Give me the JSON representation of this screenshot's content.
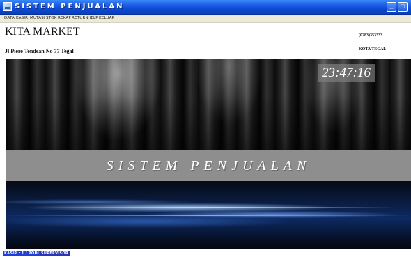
{
  "window": {
    "title": "SISTEM   PENJUALAN",
    "icon": "app-icon",
    "minimize_glyph": "_",
    "maximize_glyph": "□"
  },
  "menu": {
    "items": [
      "DATA",
      "KASIR",
      "MUTASI",
      "STOK",
      "REKAP",
      "RETURN",
      "HELP",
      "KELUAR"
    ]
  },
  "header": {
    "store_name": "KITA MARKET",
    "address": "Jl Piere Tendean No 77 Tegal",
    "phone": "(0283)353333",
    "city": "KOTA TEGAL"
  },
  "banner": {
    "clock": "23:47:16",
    "title": "SISTEM  PENJUALAN"
  },
  "status": {
    "kasir": "KASIR : 1  /  PODI",
    "role": "SUPERVISOR"
  },
  "colors": {
    "titlebar": "#0b47cf",
    "menubar": "#ece9d8",
    "band": "#8e8e8e",
    "status_kasir": "#1f3fd6",
    "status_role": "#2a35b8"
  }
}
